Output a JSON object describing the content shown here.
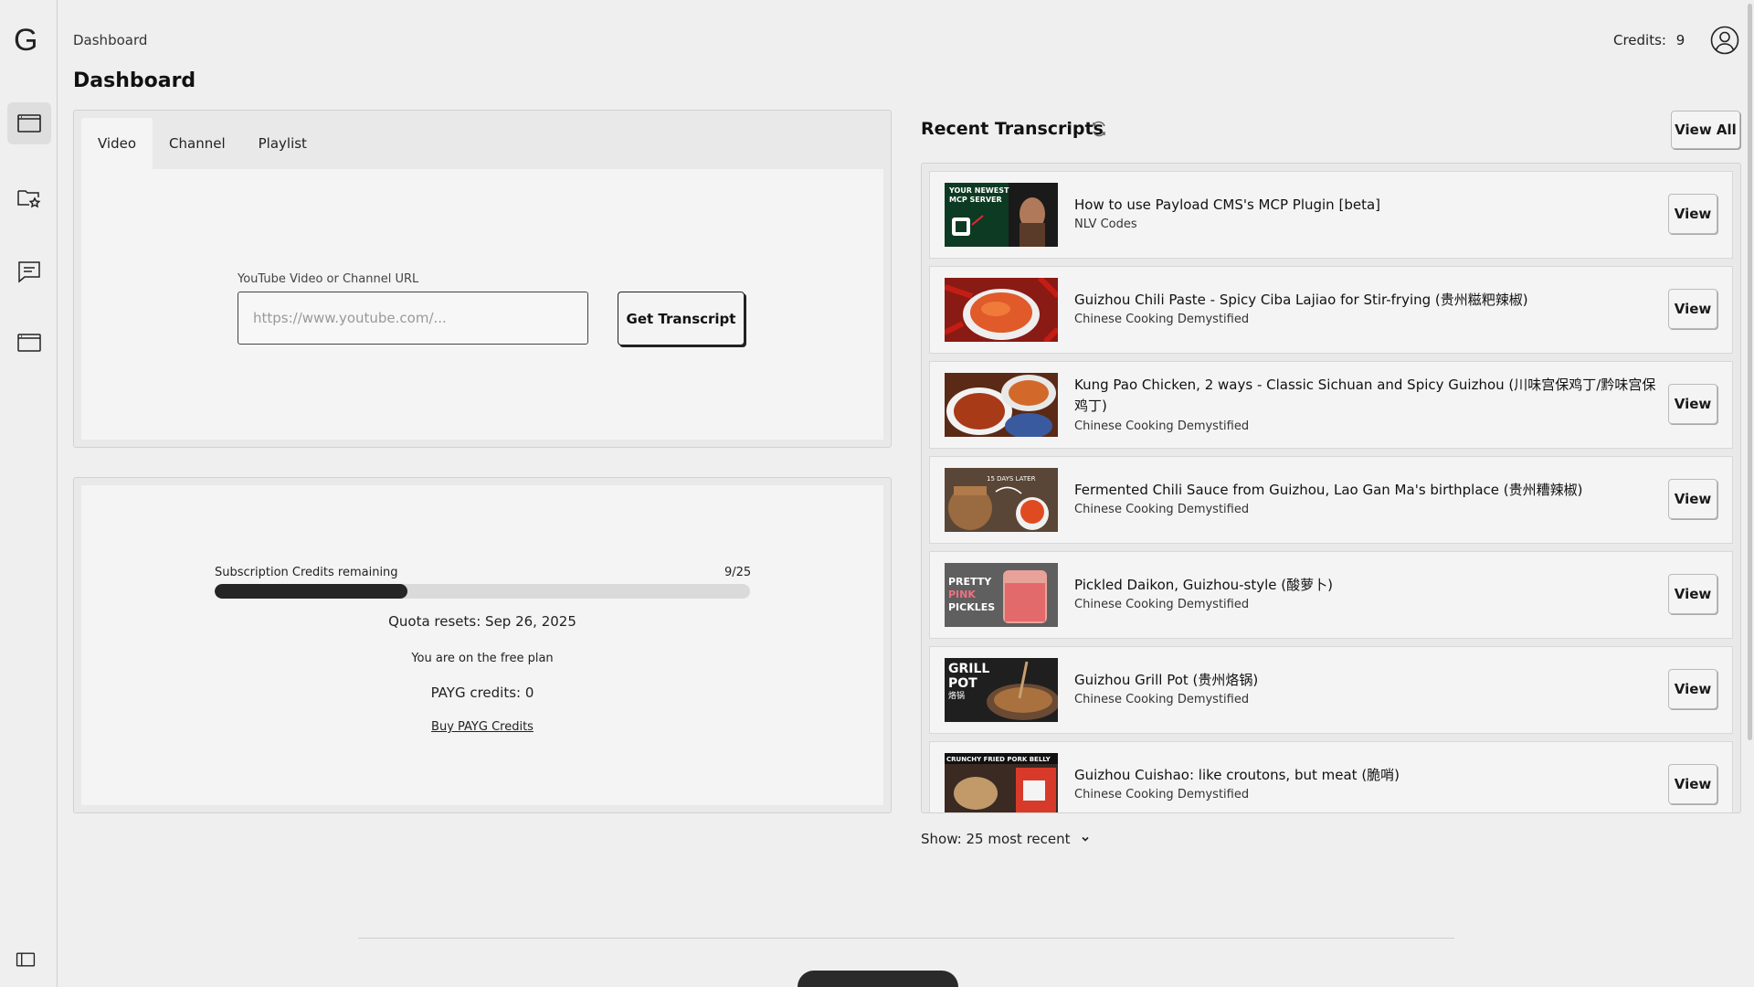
{
  "app": {
    "logo": "G"
  },
  "sidebar": {
    "items": [
      {
        "name": "dashboard",
        "icon": "window-icon",
        "active": true
      },
      {
        "name": "favorites",
        "icon": "folder-star-icon",
        "active": false
      },
      {
        "name": "messages",
        "icon": "message-icon",
        "active": false
      },
      {
        "name": "browser",
        "icon": "window-icon",
        "active": false
      }
    ],
    "toggle_icon": "sidebar-toggle-icon"
  },
  "header": {
    "breadcrumb": "Dashboard",
    "title": "Dashboard",
    "credits_label": "Credits:",
    "credits_value": "9"
  },
  "input_panel": {
    "tabs": [
      {
        "label": "Video",
        "active": true
      },
      {
        "label": "Channel",
        "active": false
      },
      {
        "label": "Playlist",
        "active": false
      }
    ],
    "url_label": "YouTube Video or Channel URL",
    "url_placeholder": "https://www.youtube.com/...",
    "url_value": "",
    "submit_label": "Get Transcript"
  },
  "credits_panel": {
    "subscription_label": "Subscription Credits remaining",
    "subscription_count": "9/25",
    "progress_fraction": 0.36,
    "quota_reset": "Quota resets: Sep 26, 2025",
    "plan_text": "You are on the free plan",
    "payg_text": "PAYG credits: 0",
    "buy_link": "Buy PAYG Credits"
  },
  "recent": {
    "title": "Recent Transcripts",
    "view_all_label": "View All",
    "view_label": "View",
    "items": [
      {
        "title": "How to use Payload CMS's MCP Plugin [beta]",
        "channel": "NLV Codes",
        "thumb_text": "YOUR NEWEST MCP SERVER"
      },
      {
        "title": "Guizhou Chili Paste - Spicy Ciba Lajiao for Stir-frying (贵州糍粑辣椒)",
        "channel": "Chinese Cooking Demystified",
        "thumb_text": ""
      },
      {
        "title": "Kung Pao Chicken, 2 ways - Classic Sichuan and Spicy Guizhou (川味宫保鸡丁/黔味宫保鸡丁)",
        "channel": "Chinese Cooking Demystified",
        "thumb_text": ""
      },
      {
        "title": "Fermented Chili Sauce from Guizhou, Lao Gan Ma's birthplace (贵州糟辣椒)",
        "channel": "Chinese Cooking Demystified",
        "thumb_text": "15 DAYS LATER"
      },
      {
        "title": "Pickled Daikon, Guizhou-style (酸萝卜)",
        "channel": "Chinese Cooking Demystified",
        "thumb_text": "PRETTY PINK PICKLES"
      },
      {
        "title": "Guizhou Grill Pot (贵州烙锅)",
        "channel": "Chinese Cooking Demystified",
        "thumb_text": "GRILL POT 烙锅"
      },
      {
        "title": "Guizhou Cuishao: like croutons, but meat (脆哨)",
        "channel": "Chinese Cooking Demystified",
        "thumb_text": "CRUNCHY FRIED PORK BELLY"
      }
    ],
    "show_label": "Show: 25 most recent"
  }
}
